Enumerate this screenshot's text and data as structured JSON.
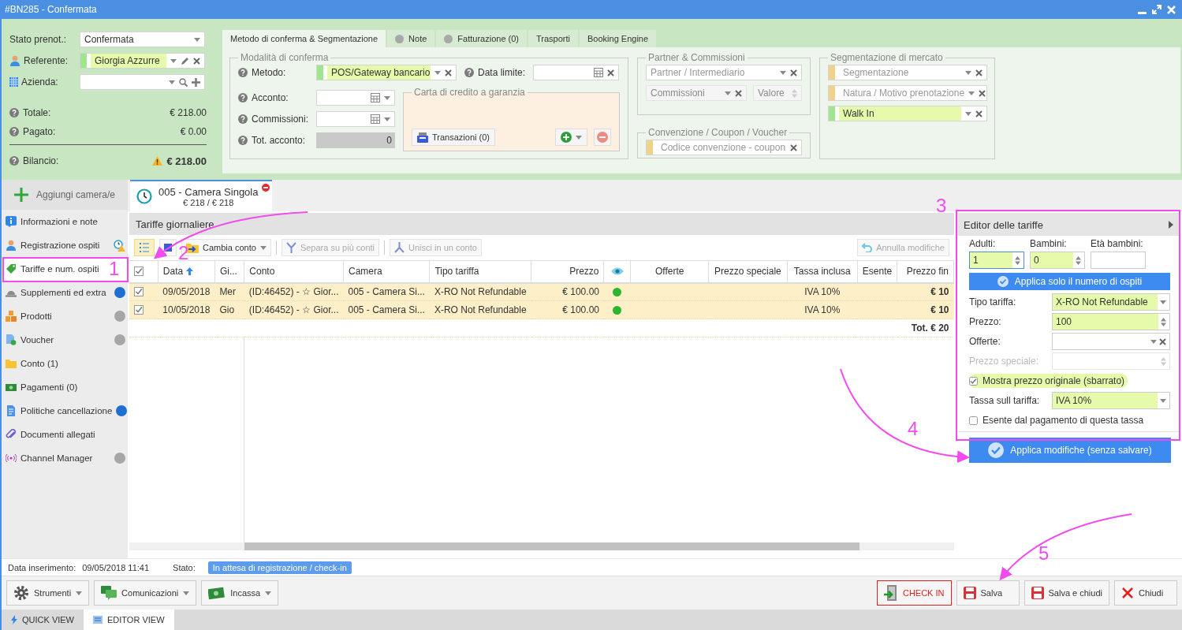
{
  "window": {
    "title": "#BN285 - Confermata"
  },
  "summary": {
    "stato": {
      "label": "Stato prenot.:",
      "value": "Confermata"
    },
    "referente": {
      "label": "Referente:",
      "value": "Giorgia Azzurre"
    },
    "azienda": {
      "label": "Azienda:"
    },
    "totals": [
      {
        "label": "Totale:",
        "value": "€ 218.00",
        "kind": "plain"
      },
      {
        "label": "Pagato:",
        "value": "€ 0.00",
        "kind": "plain"
      },
      {
        "label": "Bilancio:",
        "value": "€ 218.00",
        "kind": "warning"
      }
    ]
  },
  "top_tabs": [
    {
      "label": "Metodo di conferma & Segmentazione",
      "selected": true
    },
    {
      "label": "Note",
      "selected": false,
      "color": "#a8a8a8"
    },
    {
      "label": "Fatturazione (0)",
      "selected": false,
      "color": "#a8a8a8"
    },
    {
      "label": "Trasporti",
      "selected": false
    },
    {
      "label": "Booking Engine",
      "selected": false
    }
  ],
  "conferma": {
    "legend": "Modalità di conferma",
    "metodo": {
      "label": "Metodo:",
      "value": "POS/Gateway bancario"
    },
    "data_limite": {
      "label": "Data limite:"
    },
    "acconto": {
      "label": "Acconto:"
    },
    "commissioni": {
      "label": "Commissioni:"
    },
    "tot_acconto": {
      "label": "Tot. acconto:",
      "value": "0"
    },
    "carta": {
      "legend": "Carta di credito a garanzia",
      "button": "Transazioni (0)"
    }
  },
  "partner": {
    "legend": "Partner & Commissioni",
    "intermediario": {
      "placeholder": "Partner / Intermediario"
    },
    "commissioni": {
      "placeholder": "Commissioni",
      "disabled": true
    },
    "valore": {
      "placeholder": "Valore",
      "disabled": true
    }
  },
  "convenzione": {
    "legend": "Convenzione / Coupon / Voucher",
    "placeholder": "Codice convenzione - coupon"
  },
  "segmentazione": {
    "legend": "Segmentazione di mercato",
    "fields": [
      {
        "placeholder": "Segmentazione"
      },
      {
        "placeholder": "Natura / Motivo prenotazione"
      },
      {
        "value": "Walk In"
      }
    ]
  },
  "add_room_button": "Aggiungi camera/e",
  "room_tab": {
    "title": "005 - Camera Singola",
    "subtitle": "€ 218 / € 218"
  },
  "sidebar": {
    "items": [
      {
        "label": "Informazioni e note",
        "selected": false,
        "kind": "none"
      },
      {
        "label": "Registrazione ospiti",
        "selected": false,
        "kind": "warning"
      },
      {
        "label": "Tariffe e num. ospiti",
        "selected": true,
        "kind": "none"
      },
      {
        "label": "Supplementi ed extra",
        "selected": false,
        "kind": "dot",
        "color": "#1e6fd2"
      },
      {
        "label": "Prodotti",
        "selected": false,
        "kind": "dot",
        "color": "#a6a6a6"
      },
      {
        "label": "Voucher",
        "selected": false,
        "kind": "dot",
        "color": "#a6a6a6"
      },
      {
        "label": "Conto (1)",
        "selected": false,
        "kind": "none"
      },
      {
        "label": "Pagamenti (0)",
        "selected": false,
        "kind": "none"
      },
      {
        "label": "Politiche cancellazione",
        "selected": false,
        "kind": "dot",
        "color": "#1e6fd2"
      },
      {
        "label": "Documenti allegati",
        "selected": false,
        "kind": "none"
      },
      {
        "label": "Channel Manager",
        "selected": false,
        "kind": "dot",
        "color": "#a6a6a6"
      }
    ]
  },
  "rates": {
    "title": "Tariffe giornaliere",
    "toolbar": [
      {
        "kind": "icon",
        "selected": true
      },
      {
        "kind": "icon",
        "selected": false
      },
      {
        "kind": "menu",
        "label": "Cambia conto",
        "disabled": false
      },
      {
        "kind": "button",
        "label": "Separa su più conti",
        "disabled": true
      },
      {
        "kind": "button",
        "label": "Unisci in un conto",
        "disabled": true
      }
    ],
    "undo_button": {
      "label": "Annulla modifiche",
      "disabled": true
    },
    "table": {
      "columns": [
        {
          "kind": "check"
        },
        {
          "kind": "text",
          "label": "Data",
          "sorted": true
        },
        {
          "kind": "text",
          "label": "Gi...",
          "sorted": false
        },
        {
          "kind": "text",
          "label": "Conto",
          "sorted": false
        },
        {
          "kind": "text",
          "label": "Camera",
          "sorted": false
        },
        {
          "kind": "text",
          "label": "Tipo tariffa",
          "sorted": false
        },
        {
          "kind": "text",
          "label": "Prezzo",
          "sorted": false
        },
        {
          "kind": "eye"
        },
        {
          "kind": "text",
          "label": "Offerte",
          "sorted": false
        },
        {
          "kind": "text",
          "label": "Prezzo speciale",
          "sorted": false
        },
        {
          "kind": "text",
          "label": "Tassa inclusa",
          "sorted": false
        },
        {
          "kind": "text",
          "label": "Esente",
          "sorted": false
        },
        {
          "kind": "text",
          "label": "Prezzo fin",
          "sorted": false
        }
      ],
      "rows": [
        {
          "selected": true,
          "checked": true,
          "data": "09/05/2018",
          "giorno": "Mer",
          "conto": "(ID:46452) - ☆ Gior...",
          "camera": "005 - Camera Si...",
          "tipo_tariffa": "X-RO Not Refundable",
          "prezzo": "€ 100.00",
          "color": "#2db52d",
          "tassa_inclusa": "IVA 10%",
          "prezzo_finale": "€ 10"
        },
        {
          "selected": true,
          "checked": true,
          "data": "10/05/2018",
          "giorno": "Gio",
          "conto": "(ID:46452) - ☆ Gior...",
          "camera": "005 - Camera Si...",
          "tipo_tariffa": "X-RO Not Refundable",
          "prezzo": "€ 100.00",
          "color": "#2db52d",
          "tassa_inclusa": "IVA 10%",
          "prezzo_finale": "€ 10"
        }
      ],
      "total": "Tot. € 20"
    }
  },
  "editor": {
    "title": "Editor delle tariffe",
    "adulti": {
      "label": "Adulti:",
      "value": "1"
    },
    "bambini": {
      "label": "Bambini:",
      "value": "0"
    },
    "eta_bambini": {
      "label": "Età bambini:"
    },
    "apply_guests_button": "Applica solo il numero di ospiti",
    "rows": [
      {
        "kind": "select",
        "label": "Tipo tariffa:",
        "value": "X-RO Not Refundable",
        "disabled": false
      },
      {
        "kind": "spinner",
        "label": "Prezzo:",
        "value": "100",
        "disabled": false
      },
      {
        "kind": "select-clear",
        "label": "Offerte:",
        "disabled": false
      },
      {
        "kind": "spinner",
        "label": "Prezzo speciale:",
        "disabled": true
      },
      {
        "kind": "checkbox",
        "label": "Mostra prezzo originale (sbarrato)",
        "checked": true
      },
      {
        "kind": "select",
        "label": "Tassa sull tariffa:",
        "value": "IVA 10%",
        "disabled": false
      },
      {
        "kind": "checkbox",
        "label": "Esente dal pagamento di questa tassa",
        "checked": false
      }
    ],
    "apply_button": "Applica modifiche (senza salvare)"
  },
  "status": {
    "inserted_label": "Data inserimento:",
    "inserted_value": "09/05/2018 11:41",
    "state_label": "Stato:",
    "state_badge": "In attesa di registrazione / check-in"
  },
  "bottom_toolbar": {
    "left": [
      {
        "label": "Strumenti",
        "kind": "menu"
      },
      {
        "label": "Comunicazioni",
        "kind": "menu"
      },
      {
        "label": "Incassa",
        "kind": "menu"
      }
    ],
    "right": [
      {
        "label": "CHECK IN",
        "kind": "checkin"
      },
      {
        "label": "Salva",
        "kind": "save"
      },
      {
        "label": "Salva e chiudi",
        "kind": "save"
      },
      {
        "label": "Chiudi",
        "kind": "close"
      }
    ]
  },
  "view_tabs": [
    {
      "label": "QUICK VIEW",
      "selected": false
    },
    {
      "label": "EDITOR VIEW",
      "selected": true
    }
  ],
  "annotations": [
    {
      "label": "1"
    },
    {
      "label": "2"
    },
    {
      "label": "3"
    },
    {
      "label": "4"
    },
    {
      "label": "5"
    }
  ]
}
